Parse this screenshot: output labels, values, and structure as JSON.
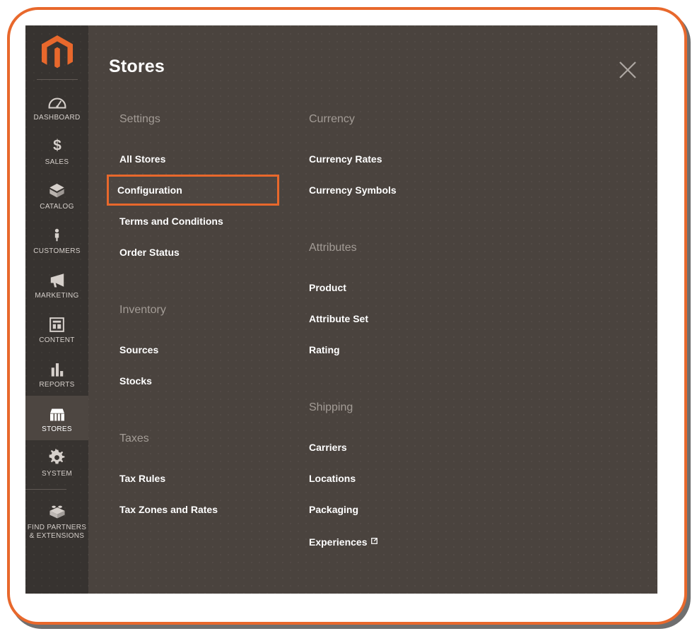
{
  "window": {
    "frame_accent_color": "#e8682c",
    "panel_bg_color": "#4a433e",
    "sidebar_bg_color": "#373330"
  },
  "header": {
    "title": "Stores",
    "close_label": "×",
    "close_icon": "close-icon"
  },
  "sidebar": {
    "logo_icon": "magento-logo-icon",
    "items": [
      {
        "label": "DASHBOARD",
        "icon": "dashboard-gauge-icon",
        "active": false
      },
      {
        "label": "SALES",
        "icon": "dollar-sign-icon",
        "active": false
      },
      {
        "label": "CATALOG",
        "icon": "catalog-box-icon",
        "active": false
      },
      {
        "label": "CUSTOMERS",
        "icon": "customers-person-icon",
        "active": false
      },
      {
        "label": "MARKETING",
        "icon": "marketing-megaphone-icon",
        "active": false
      },
      {
        "label": "CONTENT",
        "icon": "content-layout-icon",
        "active": false
      },
      {
        "label": "REPORTS",
        "icon": "reports-bar-chart-icon",
        "active": false
      },
      {
        "label": "STORES",
        "icon": "stores-storefront-icon",
        "active": true
      },
      {
        "label": "SYSTEM",
        "icon": "system-gear-icon",
        "active": false
      },
      {
        "label": "FIND PARTNERS\n& EXTENSIONS",
        "icon": "extensions-brick-icon",
        "active": false
      }
    ]
  },
  "menu": {
    "columns": [
      {
        "groups": [
          {
            "title": "Settings",
            "items": [
              {
                "label": "All Stores",
                "highlighted": false,
                "external": false
              },
              {
                "label": "Configuration",
                "highlighted": true,
                "external": false
              },
              {
                "label": "Terms and Conditions",
                "highlighted": false,
                "external": false
              },
              {
                "label": "Order Status",
                "highlighted": false,
                "external": false
              }
            ]
          },
          {
            "title": "Inventory",
            "items": [
              {
                "label": "Sources",
                "highlighted": false,
                "external": false
              },
              {
                "label": "Stocks",
                "highlighted": false,
                "external": false
              }
            ]
          },
          {
            "title": "Taxes",
            "items": [
              {
                "label": "Tax Rules",
                "highlighted": false,
                "external": false
              },
              {
                "label": "Tax Zones and Rates",
                "highlighted": false,
                "external": false
              }
            ]
          }
        ]
      },
      {
        "groups": [
          {
            "title": "Currency",
            "items": [
              {
                "label": "Currency Rates",
                "highlighted": false,
                "external": false
              },
              {
                "label": "Currency Symbols",
                "highlighted": false,
                "external": false
              }
            ]
          },
          {
            "title": "Attributes",
            "items": [
              {
                "label": "Product",
                "highlighted": false,
                "external": false
              },
              {
                "label": "Attribute Set",
                "highlighted": false,
                "external": false
              },
              {
                "label": "Rating",
                "highlighted": false,
                "external": false
              }
            ]
          },
          {
            "title": "Shipping",
            "items": [
              {
                "label": "Carriers",
                "highlighted": false,
                "external": false
              },
              {
                "label": "Locations",
                "highlighted": false,
                "external": false
              },
              {
                "label": "Packaging",
                "highlighted": false,
                "external": false
              },
              {
                "label": "Experiences",
                "highlighted": false,
                "external": true
              }
            ]
          }
        ]
      }
    ]
  }
}
